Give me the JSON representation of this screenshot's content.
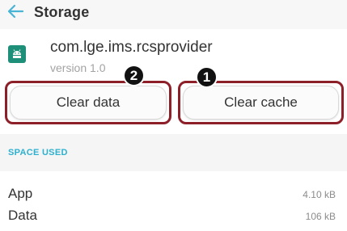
{
  "header": {
    "title": "Storage",
    "back_icon": "back-arrow-icon"
  },
  "app": {
    "package": "com.lge.ims.rcsprovider",
    "version": "version 1.0",
    "icon": "android-icon",
    "icon_color": "#1e8f78"
  },
  "buttons": {
    "clear_data": "Clear data",
    "clear_cache": "Clear cache"
  },
  "annotations": {
    "badge_1": "1",
    "badge_2": "2",
    "highlight_color": "#8c1f28"
  },
  "space_used": {
    "heading": "SPACE USED",
    "rows": [
      {
        "label": "App",
        "value": "4.10 kB"
      },
      {
        "label": "Data",
        "value": "106 kB"
      }
    ]
  },
  "colors": {
    "accent": "#2db1cf",
    "back_arrow": "#49b4d4"
  }
}
